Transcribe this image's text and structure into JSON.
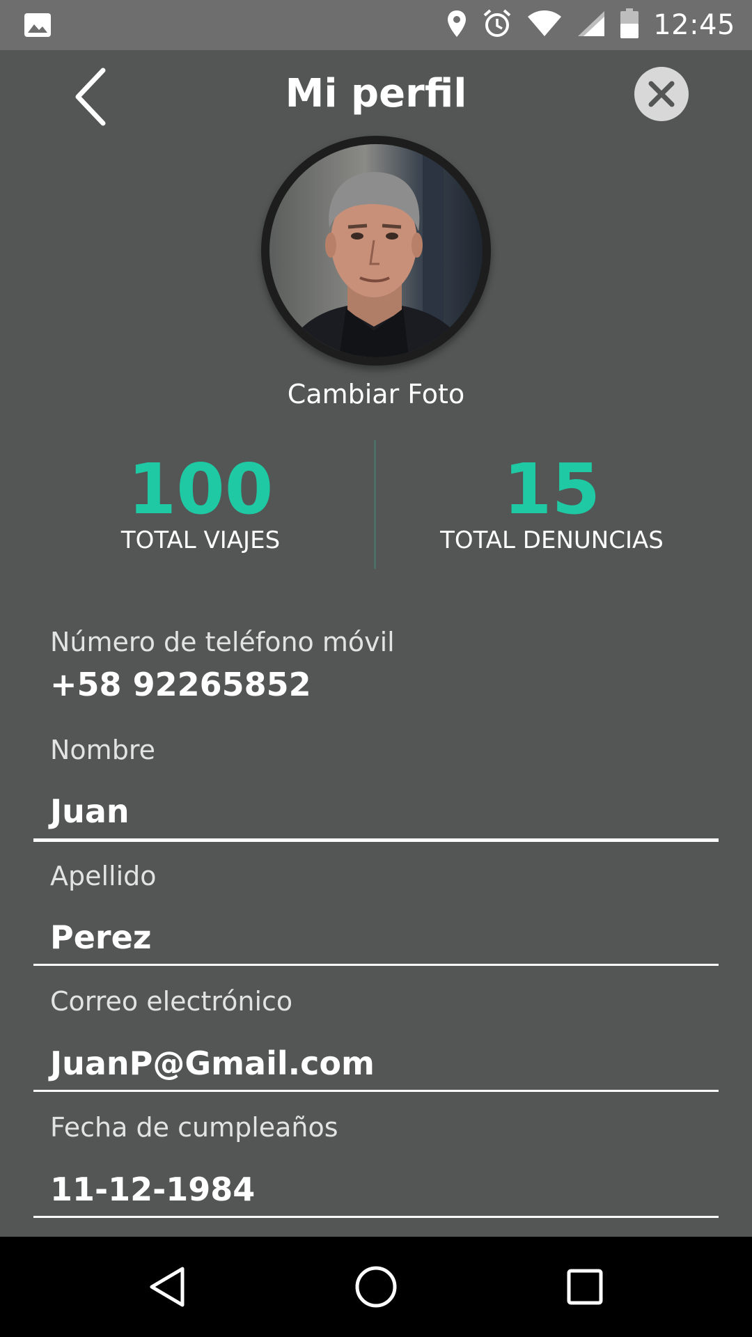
{
  "status_bar": {
    "time": "12:45",
    "icons": [
      "image-icon",
      "location-icon",
      "alarm-icon",
      "wifi-icon",
      "signal-icon",
      "battery-icon"
    ]
  },
  "header": {
    "title": "Mi perfil",
    "back_icon": "back-arrow-icon",
    "close_icon": "close-icon"
  },
  "profile": {
    "change_photo_label": "Cambiar Foto"
  },
  "stats": [
    {
      "value": "100",
      "label": "TOTAL VIAJES"
    },
    {
      "value": "15",
      "label": "TOTAL DENUNCIAS"
    }
  ],
  "form": {
    "phone": {
      "label": "Número de teléfono móvil",
      "value": "+58 92265852"
    },
    "first_name": {
      "label": "Nombre",
      "value": "Juan"
    },
    "last_name": {
      "label": "Apellido",
      "value": "Perez"
    },
    "email": {
      "label": "Correo electrónico",
      "value": "JuanP@Gmail.com"
    },
    "birthday": {
      "label": "Fecha de cumpleaños",
      "value": "11-12-1984"
    }
  },
  "nav_bar": {
    "icons": [
      "nav-back-icon",
      "nav-home-icon",
      "nav-recents-icon"
    ]
  },
  "colors": {
    "background": "#535655",
    "status_bar": "#6e6e6e",
    "accent": "#1ec9a4",
    "nav_bar": "#000000"
  }
}
